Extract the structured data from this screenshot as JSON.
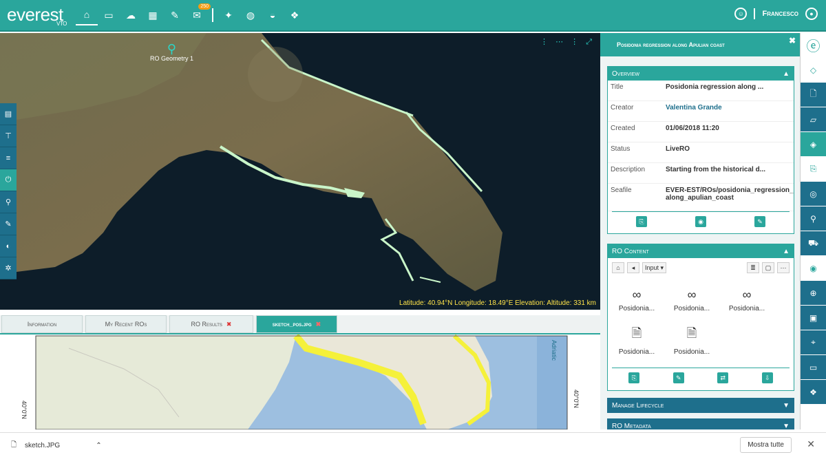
{
  "app": {
    "logo": "everest",
    "logo_sub": "VTO",
    "user": "Francesco",
    "notif_count": "250"
  },
  "map": {
    "marker_label": "RO Geometry 1",
    "coords": "Latitude: 40.94°N  Longitude: 18.49°E  Elevation:   Altitude: 331 km"
  },
  "tabs": [
    {
      "label": "Information"
    },
    {
      "label": "My Recent ROs"
    },
    {
      "label": "RO Results"
    },
    {
      "label": "sketch_pos.jpg"
    }
  ],
  "sketch": {
    "lat_left": "40°0'N",
    "lat_right": "40°0'N",
    "sea_label": "Adriatic"
  },
  "panel": {
    "title": "Posidonia regression along Apulian coast",
    "overview": {
      "header": "Overview",
      "rows": [
        {
          "k": "Title",
          "v": "Posidonia regression along ..."
        },
        {
          "k": "Creator",
          "v": "Valentina Grande"
        },
        {
          "k": "Created",
          "v": "01/06/2018 11:20"
        },
        {
          "k": "Status",
          "v": "LiveRO"
        },
        {
          "k": "Description",
          "v": "Starting from the historical d..."
        },
        {
          "k": "Seafile",
          "v": "EVER-EST/ROs/posidonia_regression_along_apulian_coast"
        }
      ]
    },
    "content": {
      "header": "RO Content",
      "input": "Input",
      "items": [
        "Posidonia...",
        "Posidonia...",
        "Posidonia...",
        "Posidonia...",
        "Posidonia..."
      ]
    },
    "lifecycle": "Manage Lifecycle",
    "metadata": "RO Metadata"
  },
  "downloads": {
    "file": "sketch.JPG",
    "show_all": "Mostra tutte"
  }
}
